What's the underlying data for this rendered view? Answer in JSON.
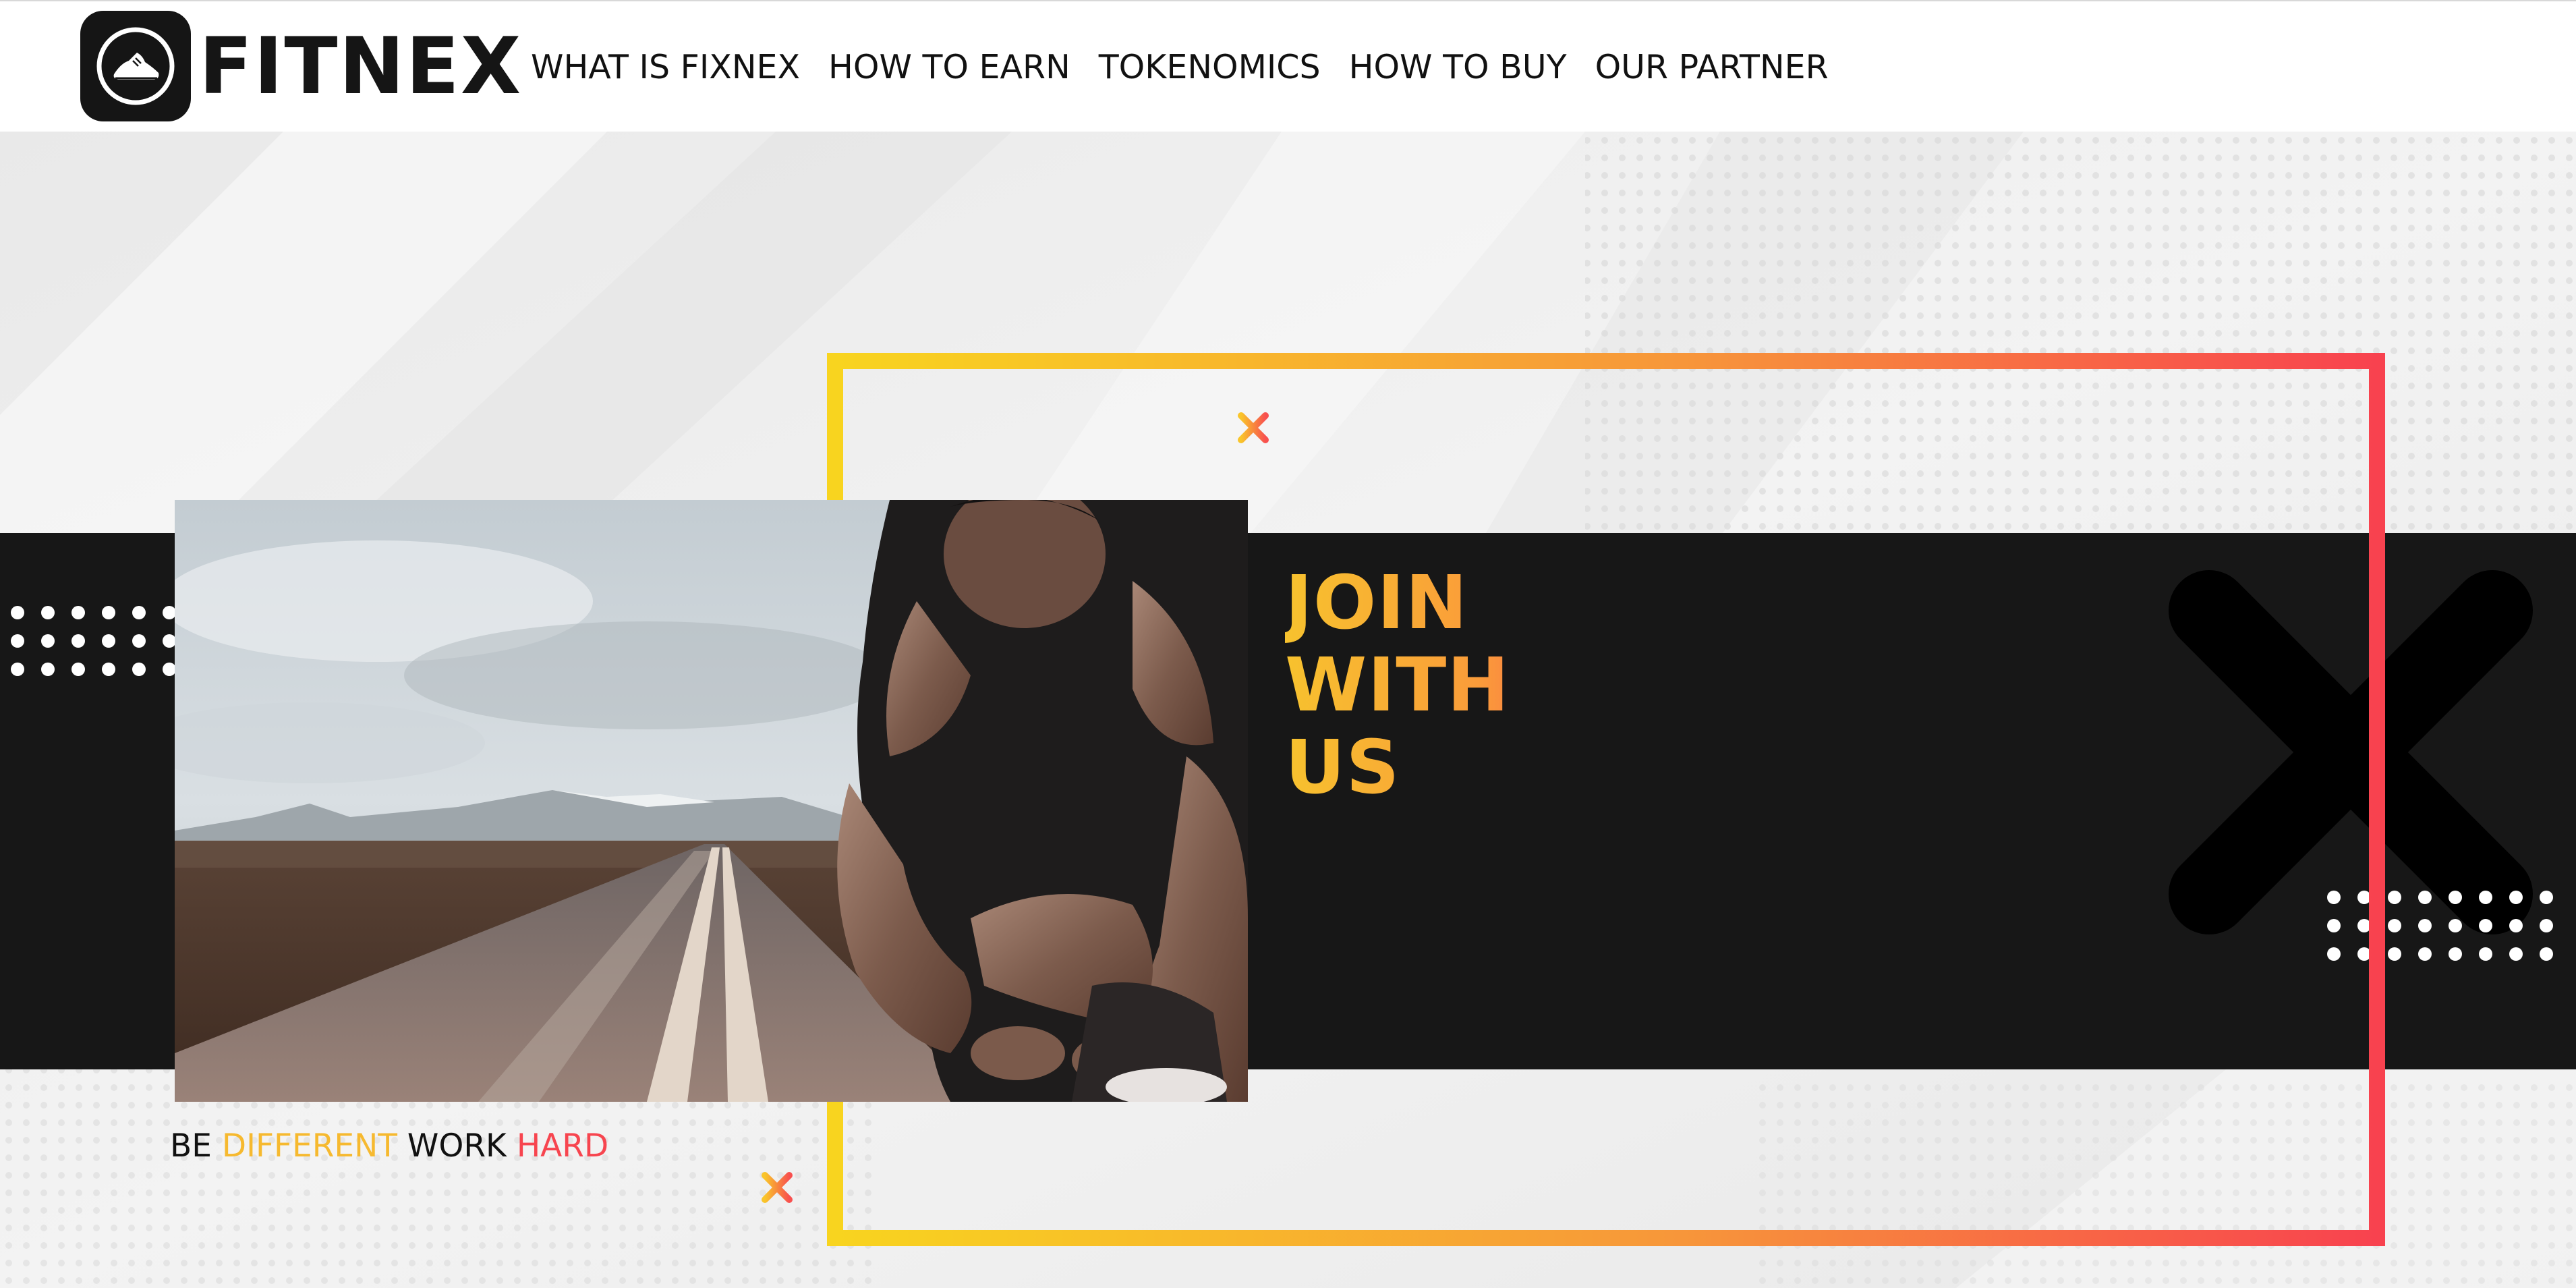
{
  "header": {
    "logo_text": "FITNEX",
    "nav": [
      "WHAT IS FIXNEX",
      "HOW TO EARN",
      "TOKENOMICS",
      "HOW TO BUY",
      "OUR PARTNER"
    ]
  },
  "hero": {
    "title_lines": [
      "JOIN",
      "WITH",
      "US"
    ],
    "tagline": {
      "w1": "BE",
      "w2": "DIFFERENT",
      "w3": "WORK",
      "w4": "HARD"
    }
  },
  "colors": {
    "accent_yellow": "#f7d21f",
    "accent_orange": "#f7923c",
    "accent_red": "#f8444f",
    "band": "#171717",
    "logo_dark": "#151515"
  },
  "icons": {
    "logo": "running-shoe-icon",
    "decor_cross": "x-mark-icon"
  }
}
